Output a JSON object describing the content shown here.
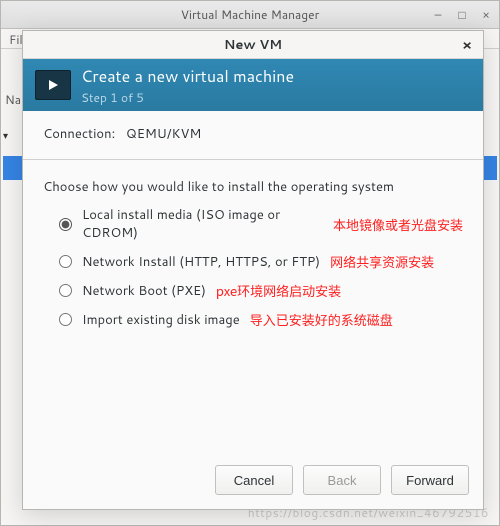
{
  "main_window": {
    "title": "Virtual Machine Manager",
    "file_menu": "File",
    "name_col": "Na",
    "caret": "▾",
    "group_label": "(",
    "watermark": "https://blog.csdn.net/weixin_46792516"
  },
  "dialog": {
    "title": "New VM",
    "header_title": "Create a new virtual machine",
    "header_step": "Step 1 of 5",
    "connection_label": "Connection:",
    "connection_value": "QEMU/KVM",
    "choose_label": "Choose how you would like to install the operating system",
    "options": [
      {
        "label": "Local install media (ISO image or CDROM)",
        "annot": "本地镜像或者光盘安装",
        "checked": true
      },
      {
        "label": "Network Install (HTTP, HTTPS, or FTP)",
        "annot": "网络共享资源安装",
        "checked": false
      },
      {
        "label": "Network Boot (PXE)",
        "annot": "pxe环境网络启动安装",
        "checked": false
      },
      {
        "label": "Import existing disk image",
        "annot": "导入已安装好的系统磁盘",
        "checked": false
      }
    ],
    "buttons": {
      "cancel": "Cancel",
      "back": "Back",
      "forward": "Forward"
    }
  }
}
